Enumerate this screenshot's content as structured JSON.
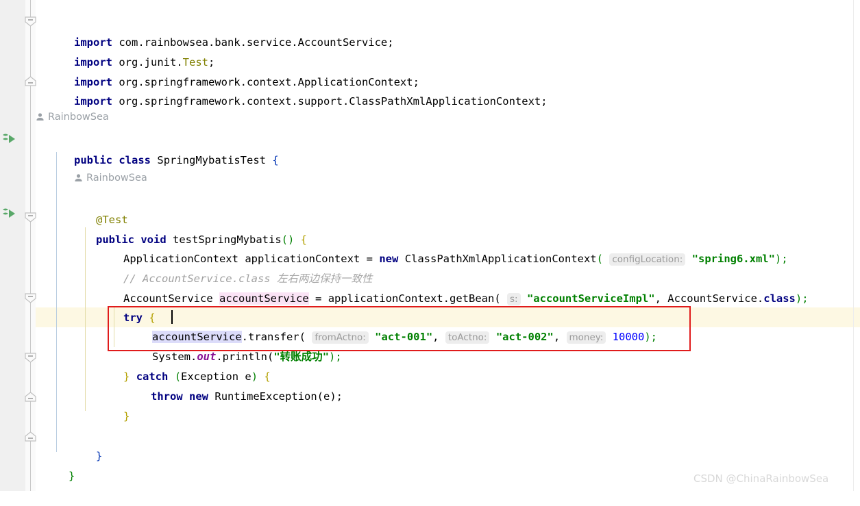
{
  "editor": {
    "watermark": "CSDN @ChinaRainbowSea",
    "colors": {
      "keyword": "#000080",
      "string": "#008000",
      "number": "#0000ff",
      "annotation": "#808000",
      "comment": "#a0a0a0",
      "static_field": "#871094",
      "highlight_line": "#fdf8e3",
      "identifier_highlight": "#dcdcfa",
      "pink_highlight": "#fae3f5",
      "annotation_box": "#e01b1b",
      "gutter": "#f0f0f0"
    }
  },
  "vcs_annotations": [
    {
      "author": "RainbowSea",
      "icon": "person-icon"
    },
    {
      "author": "RainbowSea",
      "icon": "person-icon"
    }
  ],
  "gutter": {
    "run_icons": [
      {
        "name": "run-test-class-icon",
        "tooltip": "Run Test"
      },
      {
        "name": "run-test-method-icon",
        "tooltip": "Run Test"
      }
    ],
    "fold_markers": [
      {
        "type": "collapse-top",
        "name": "fold-imports"
      },
      {
        "type": "collapse-bottom",
        "name": "fold-imports-end"
      },
      {
        "type": "collapse-top",
        "name": "fold-method"
      },
      {
        "type": "collapse-top",
        "name": "fold-try"
      },
      {
        "type": "collapse-top",
        "name": "fold-catch"
      },
      {
        "type": "collapse-bottom",
        "name": "fold-catch-end"
      },
      {
        "type": "collapse-bottom",
        "name": "fold-method-end"
      }
    ]
  },
  "code": {
    "imports": [
      {
        "kw": "import",
        "path": " com.rainbowsea.bank.service.AccountService;"
      },
      {
        "kw": "import",
        "path": " org.junit.",
        "type": "Test",
        "tail": ";"
      },
      {
        "kw": "import",
        "path": " org.springframework.context.ApplicationContext;"
      },
      {
        "kw": "import",
        "path": " org.springframework.context.support.ClassPathXmlApplicationContext;"
      }
    ],
    "class_decl": {
      "modifier": "public",
      "keyword": "class",
      "name": "SpringMybatisTest",
      "brace": "{"
    },
    "annotation": "@Test",
    "method_decl": {
      "modifier": "public",
      "return_type": "void",
      "name": "testSpringMybatis",
      "parens": "()",
      "brace": "{"
    },
    "line_context": {
      "type": "ApplicationContext",
      "var": "applicationContext",
      "eq": "=",
      "new_kw": "new",
      "ctor": "ClassPathXmlApplicationContext",
      "hint": "configLocation:",
      "arg": "\"spring6.xml\"",
      "tail": ");"
    },
    "comment_line": {
      "slashes": "// AccountService.class",
      "cjk": "左右两边保持一致性"
    },
    "line_getbean": {
      "type": "AccountService",
      "var": "accountService",
      "eq": "=",
      "call": "applicationContext.getBean(",
      "hint": "s:",
      "arg1": "\"accountServiceImpl\"",
      "sep": ", ",
      "arg2": "AccountService.",
      "class_kw": "class",
      "tail": ");"
    },
    "try_line": {
      "kw": "try",
      "brace": "{"
    },
    "line_transfer": {
      "receiver": "accountService",
      "method": ".transfer(",
      "hint1": "fromActno:",
      "arg1": "\"act-001\"",
      "hint2": "toActno:",
      "arg2": "\"act-002\"",
      "hint3": "money:",
      "arg3": "10000",
      "tail": ");"
    },
    "line_println": {
      "prefix": "System.",
      "field": "out",
      "call": ".println(",
      "quote_open": "\"",
      "cjk": "转账成功",
      "quote_close": "\"",
      "tail": ");"
    },
    "catch_line": {
      "close_brace": "}",
      "kw": "catch",
      "paren_open": "(",
      "type": "Exception",
      "var": " e",
      "paren_close": ")",
      "brace": "{"
    },
    "throw_line": {
      "kw1": "throw",
      "kw2": "new",
      "expr": "RuntimeException(e);"
    },
    "close_try": "}",
    "close_method": "}",
    "close_class": "}"
  }
}
